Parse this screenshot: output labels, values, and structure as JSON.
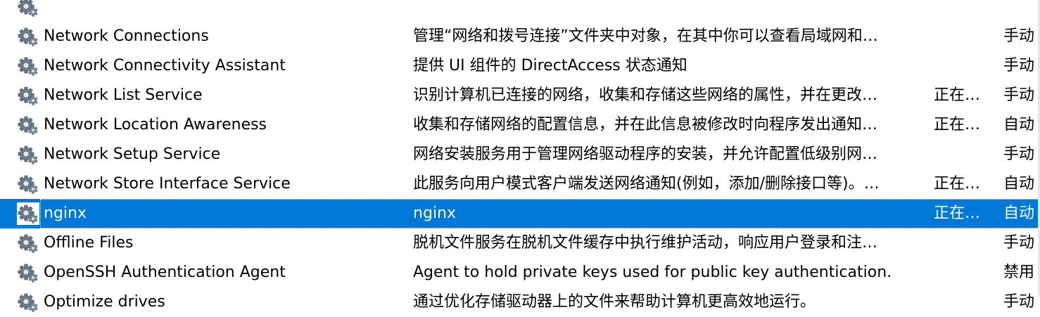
{
  "icon": "gear-service-icon",
  "colors": {
    "selection": "#0078d7",
    "selection_text": "#ffffff",
    "text": "#000000",
    "background": "#ffffff"
  },
  "services": [
    {
      "name": "",
      "description": "",
      "status": "",
      "startup": ""
    },
    {
      "name": "Network Connections",
      "description": "管理“网络和拨号连接”文件夹中对象，在其中你可以查看局域网和…",
      "status": "",
      "startup": "手动"
    },
    {
      "name": "Network Connectivity Assistant",
      "description": "提供 UI 组件的 DirectAccess 状态通知",
      "status": "",
      "startup": "手动"
    },
    {
      "name": "Network List Service",
      "description": "识别计算机已连接的网络，收集和存储这些网络的属性，并在更改…",
      "status": "正在…",
      "startup": "手动"
    },
    {
      "name": "Network Location Awareness",
      "description": "收集和存储网络的配置信息，并在此信息被修改时向程序发出通知…",
      "status": "正在…",
      "startup": "自动"
    },
    {
      "name": "Network Setup Service",
      "description": "网络安装服务用于管理网络驱动程序的安装，并允许配置低级别网…",
      "status": "",
      "startup": "手动"
    },
    {
      "name": "Network Store Interface Service",
      "description": "此服务向用户模式客户端发送网络通知(例如，添加/删除接口等)。…",
      "status": "正在…",
      "startup": "自动"
    },
    {
      "name": "nginx",
      "description": "nginx",
      "status": "正在…",
      "startup": "自动",
      "selected": true
    },
    {
      "name": "Offline Files",
      "description": "脱机文件服务在脱机文件缓存中执行维护活动，响应用户登录和注…",
      "status": "",
      "startup": "手动"
    },
    {
      "name": "OpenSSH Authentication Agent",
      "description": "Agent to hold private keys used for public key authentication.",
      "status": "",
      "startup": "禁用"
    },
    {
      "name": "Optimize drives",
      "description": "通过优化存储驱动器上的文件来帮助计算机更高效地运行。",
      "status": "",
      "startup": "手动"
    }
  ]
}
